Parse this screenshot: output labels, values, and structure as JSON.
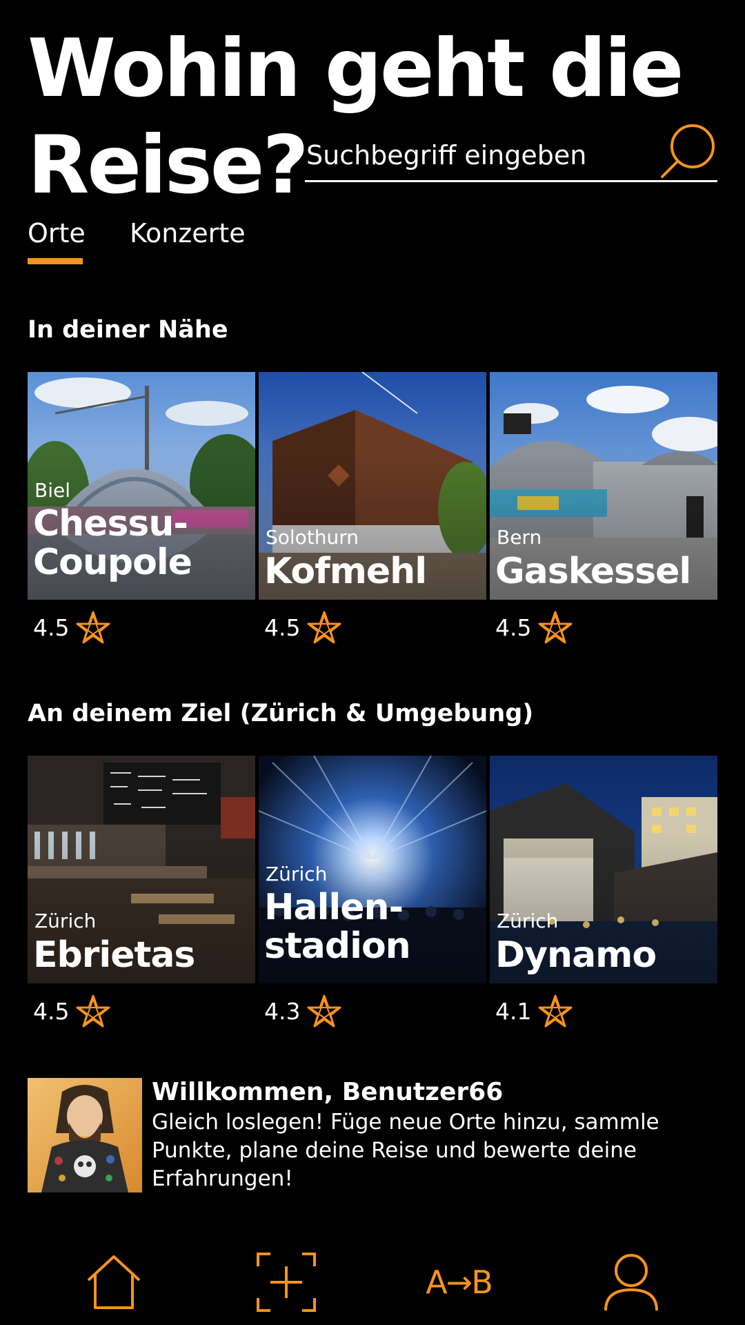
{
  "header": {
    "title_line1": "Wohin geht die",
    "title_line2": "Reise?",
    "search_placeholder": "Suchbegriff eingeben"
  },
  "tabs": [
    {
      "label": "Orte",
      "active": true
    },
    {
      "label": "Konzerte",
      "active": false
    }
  ],
  "sections": {
    "nearby": {
      "title": "In deiner Nähe",
      "cards": [
        {
          "city": "Biel",
          "name_line1": "Chessu-",
          "name_line2": "Coupole",
          "rating": "4.5"
        },
        {
          "city": "Solothurn",
          "name_line1": "",
          "name_line2": "Kofmehl",
          "rating": "4.5"
        },
        {
          "city": "Bern",
          "name_line1": "",
          "name_line2": "Gaskessel",
          "rating": "4.5"
        }
      ]
    },
    "destination": {
      "title": "An deinem Ziel (Zürich & Umgebung)",
      "cards": [
        {
          "city": "Zürich",
          "name_line1": "",
          "name_line2": "Ebrietas",
          "rating": "4.5"
        },
        {
          "city": "Zürich",
          "name_line1": "Hallen-",
          "name_line2": "stadion",
          "rating": "4.3"
        },
        {
          "city": "Zürich",
          "name_line1": "",
          "name_line2": "Dynamo",
          "rating": "4.1"
        }
      ]
    }
  },
  "welcome": {
    "title": "Willkommen, Benutzer66",
    "text": "Gleich loslegen! Füge neue Orte hinzu, sammle Punkte, plane deine Reise und bewerte deine Erfahrungen!"
  },
  "bottom_nav": {
    "route_label": "A→B"
  },
  "colors": {
    "accent": "#f7931e",
    "background": "#000000",
    "text": "#ffffff"
  }
}
